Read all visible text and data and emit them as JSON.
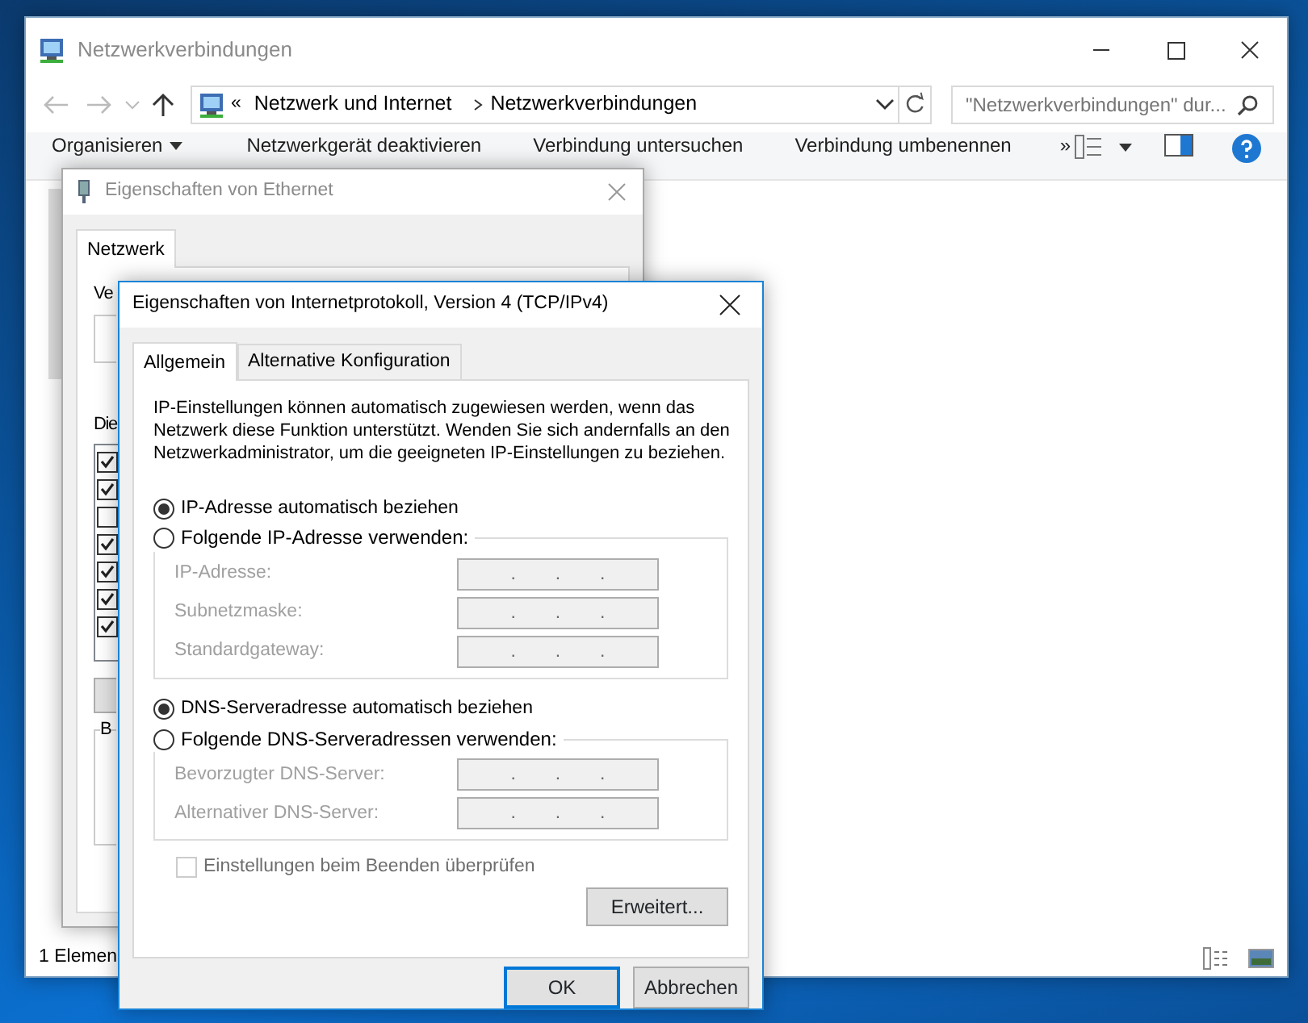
{
  "explorer": {
    "title": "Netzwerkverbindungen",
    "breadcrumb_prefix": "«",
    "breadcrumb": [
      "Netzwerk und Internet",
      "Netzwerkverbindungen"
    ],
    "search": {
      "placeholder": "\"Netzwerkverbindungen\" dur..."
    },
    "toolbar": [
      {
        "label": "Organisieren",
        "dropdown": true
      },
      {
        "label": "Netzwerkgerät deaktivieren",
        "dropdown": false
      },
      {
        "label": "Verbindung untersuchen",
        "dropdown": false
      },
      {
        "label": "Verbindung umbenennen",
        "dropdown": false
      },
      {
        "label": "»",
        "dropdown": false
      }
    ],
    "status_bar": "1 Elemen"
  },
  "ethernet_dialog": {
    "title": "Eigenschaften von Ethernet",
    "tabs": [
      {
        "label": "Netzwerk",
        "selected": true
      }
    ],
    "connect_label": "Ve",
    "items_label": "Die",
    "group_label": "B",
    "components": [
      {
        "checked": true
      },
      {
        "checked": true
      },
      {
        "checked": false
      },
      {
        "checked": true
      },
      {
        "checked": true
      },
      {
        "checked": true
      },
      {
        "checked": true
      }
    ]
  },
  "ipv4_dialog": {
    "title": "Eigenschaften von Internetprotokoll, Version 4 (TCP/IPv4)",
    "tabs": [
      {
        "label": "Allgemein",
        "selected": true
      },
      {
        "label": "Alternative Konfiguration",
        "selected": false
      }
    ],
    "description": "IP-Einstellungen können automatisch zugewiesen werden, wenn das Netzwerk diese Funktion unterstützt. Wenden Sie sich andernfalls an den Netzwerkadministrator, um die geeigneten IP-Einstellungen zu beziehen.",
    "sections": [
      {
        "auto": {
          "label": "IP-Adresse automatisch beziehen",
          "selected": true
        },
        "manual": {
          "label": "Folgende IP-Adresse verwenden:",
          "selected": false
        },
        "fields": [
          {
            "label": "IP-Adresse:",
            "dots": [
              ".",
              ".",
              "."
            ],
            "disabled": true
          },
          {
            "label": "Subnetzmaske:",
            "dots": [
              ".",
              ".",
              "."
            ],
            "disabled": true
          },
          {
            "label": "Standardgateway:",
            "dots": [
              ".",
              ".",
              "."
            ],
            "disabled": true
          }
        ]
      },
      {
        "auto": {
          "label": "DNS-Serveradresse automatisch beziehen",
          "selected": true
        },
        "manual": {
          "label": "Folgende DNS-Serveradressen verwenden:",
          "selected": false
        },
        "fields": [
          {
            "label": "Bevorzugter DNS-Server:",
            "dots": [
              ".",
              ".",
              "."
            ],
            "disabled": true
          },
          {
            "label": "Alternativer DNS-Server:",
            "dots": [
              ".",
              ".",
              "."
            ],
            "disabled": true
          }
        ]
      }
    ],
    "validate": {
      "label": "Einstellungen beim Beenden überprüfen",
      "checked": false,
      "disabled": true
    },
    "advanced_button": "Erweitert...",
    "buttons": [
      {
        "label": "OK",
        "default": true
      },
      {
        "label": "Abbrechen",
        "default": false
      }
    ]
  }
}
